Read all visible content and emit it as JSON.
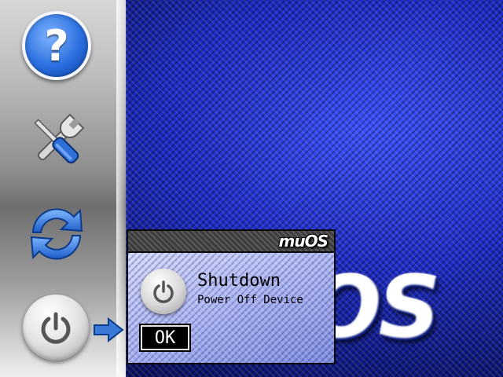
{
  "background": {
    "brand_text": "OS"
  },
  "sidebar": {
    "items": [
      {
        "name": "help",
        "icon": "help-icon",
        "glyph": "?"
      },
      {
        "name": "tools",
        "icon": "wrench-screwdriver-icon"
      },
      {
        "name": "refresh",
        "icon": "refresh-icon"
      },
      {
        "name": "power",
        "icon": "power-icon",
        "selected": true
      }
    ],
    "pointer_icon": "arrow-right-icon"
  },
  "dialog": {
    "logo": "muOS",
    "icon": "power-icon",
    "title": "Shutdown",
    "subtitle": "Power Off Device",
    "ok_label": "OK"
  },
  "colors": {
    "background_blue": "#1d2bc7",
    "dialog_bg": "#a9b3f0",
    "titlebar": "#4a4a4a"
  }
}
